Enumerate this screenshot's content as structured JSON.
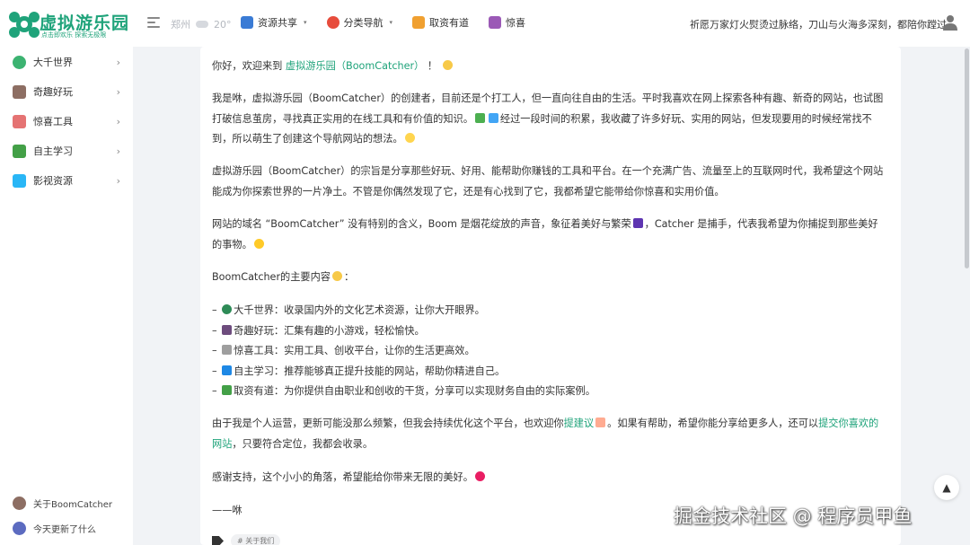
{
  "header": {
    "logo_title": "虚拟游乐园",
    "logo_slogan": "点击即欢乐 探索无极限",
    "weather_city": "郑州",
    "weather_temp": "20°",
    "nav": [
      {
        "label": "资源共享",
        "icon": "share-icon",
        "color": "#3a7bd5",
        "has_caret": true
      },
      {
        "label": "分类导航",
        "icon": "fire-icon",
        "color": "#e74c3c",
        "has_caret": true
      },
      {
        "label": "取资有道",
        "icon": "money-doc-icon",
        "color": "#f0a030",
        "has_caret": false
      },
      {
        "label": "惊喜",
        "icon": "gift-icon",
        "color": "#9b59b6",
        "has_caret": false
      }
    ],
    "quote": "祈愿万家灯火熨烫过脉络，刀山与火海多深刻，都陪你蹚过。"
  },
  "sidebar": {
    "items": [
      {
        "label": "大千世界",
        "icon": "globe-icon",
        "color": "#3cb371"
      },
      {
        "label": "奇趣好玩",
        "icon": "game-icon",
        "color": "#8d6e63"
      },
      {
        "label": "惊喜工具",
        "icon": "toolbox-icon",
        "color": "#e57373"
      },
      {
        "label": "自主学习",
        "icon": "study-icon",
        "color": "#43a047"
      },
      {
        "label": "影视资源",
        "icon": "video-icon",
        "color": "#29b6f6"
      }
    ],
    "footer": [
      {
        "label": "关于BoomCatcher",
        "icon": "badge-icon",
        "color": "#8d6e63"
      },
      {
        "label": "今天更新了什么",
        "icon": "compass-icon",
        "color": "#5c6bc0"
      }
    ]
  },
  "content": {
    "greeting_pre": "你好，欢迎来到",
    "greeting_link": "虚拟游乐园（BoomCatcher）",
    "greeting_post": "！",
    "p1": "我是咻，虚拟游乐园（BoomCatcher）的创建者，目前还是个打工人，但一直向往自由的生活。平时我喜欢在网上探索各种有趣、新奇的网站，也试图打破信息茧房，寻找真正实用的在线工具和有价值的知识。",
    "p1b": "经过一段时间的积累，我收藏了许多好玩、实用的网站，但发现要用的时候经常找不到，所以萌生了创建这个导航网站的想法。",
    "p2": "虚拟游乐园（BoomCatcher）的宗旨是分享那些好玩、好用、能帮助你赚钱的工具和平台。在一个充满广告、流量至上的互联网时代，我希望这个网站能成为你探索世界的一片净土。不管是你偶然发现了它，还是有心找到了它，我都希望它能带给你惊喜和实用价值。",
    "p3a": "网站的域名 “BoomCatcher” 没有特别的含义，Boom 是烟花绽放的声音，象征着美好与繁荣",
    "p3b": "，Catcher 是捕手，代表我希望为你捕捉到那些美好的事物。",
    "list_title": "BoomCatcher的主要内容",
    "list": [
      {
        "text": "大千世界：收录国内外的文化艺术资源，让你大开眼界。",
        "icon": "globe-icon",
        "color": "#2e8b57"
      },
      {
        "text": "奇趣好玩：汇集有趣的小游戏，轻松愉快。",
        "icon": "gamepad-icon",
        "color": "#6d4c7d"
      },
      {
        "text": "惊喜工具：实用工具、创收平台，让你的生活更高效。",
        "icon": "tools-icon",
        "color": "#9e9e9e"
      },
      {
        "text": "自主学习：推荐能够真正提升技能的网站，帮助你精进自己。",
        "icon": "book-icon",
        "color": "#1e88e5"
      },
      {
        "text": "取资有道：为你提供自由职业和创收的干货，分享可以实现财务自由的实际案例。",
        "icon": "money-icon",
        "color": "#43a047"
      }
    ],
    "p4a": "由于我是个人运营，更新可能没那么频繁，但我会持续优化这个平台，也欢迎你",
    "p4_link1": "提建议",
    "p4b": "。如果有帮助，希望你能分享给更多人，还可以",
    "p4_link2": "提交你喜欢的网站",
    "p4c": "，只要符合定位，我都会收录。",
    "p5": "感谢支持，这个小小的角落，希望能给你带来无限的美好。",
    "signature": "——咻",
    "tag": "# 关于我们"
  },
  "watermark": "掘金技术社区 @ 程序员甲鱼",
  "backtop_label": "▲"
}
